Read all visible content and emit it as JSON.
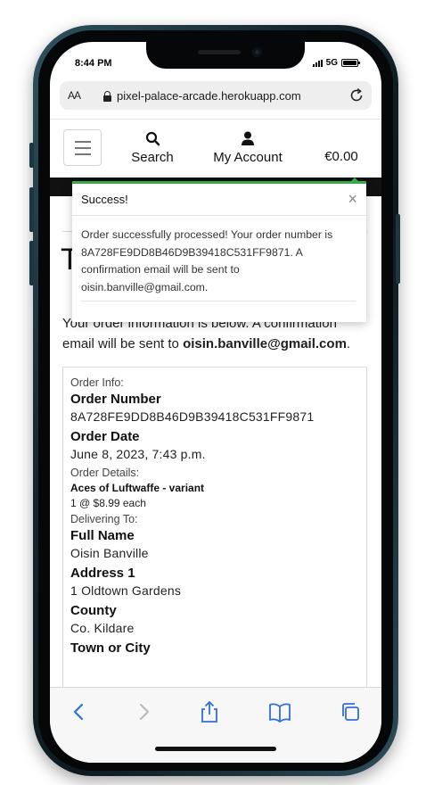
{
  "status_bar": {
    "time": "8:44 PM",
    "network": "5G"
  },
  "browser": {
    "text_size_label": "AA",
    "url": "pixel-palace-arcade.herokuapp.com"
  },
  "nav": {
    "search_label": "Search",
    "account_label": "My Account",
    "bag_total": "€0.00"
  },
  "toast": {
    "title": "Success!",
    "close": "×",
    "message": "Order successfully processed! Your order number is 8A728FE9DD8B46D9B39418C531FF9871. A confirmation email will be sent to oisin.banville@gmail.com."
  },
  "page": {
    "title": "T",
    "intro_prefix": "Your order information is below. A confirmation email will be sent to ",
    "intro_email": "oisin.banville@gmail.com",
    "intro_suffix": "."
  },
  "order": {
    "order_info_label": "Order Info:",
    "order_number_label": "Order Number",
    "order_number": "8A728FE9DD8B46D9B39418C531FF9871",
    "order_date_label": "Order Date",
    "order_date": "June 8, 2023, 7:43 p.m.",
    "order_details_label": "Order Details:",
    "item_name": "Aces of Luftwaffe - variant",
    "item_qty": "1 @ $8.99 each",
    "delivering_label": "Delivering To:",
    "full_name_label": "Full Name",
    "full_name": "Oisin Banville",
    "address1_label": "Address 1",
    "address1": "1 Oldtown Gardens",
    "county_label": "County",
    "county": "Co. Kildare",
    "town_label": "Town or City"
  },
  "colors": {
    "success": "#3ba84e",
    "toolbar_blue": "#2f6fd6",
    "header_dark": "#111111"
  }
}
